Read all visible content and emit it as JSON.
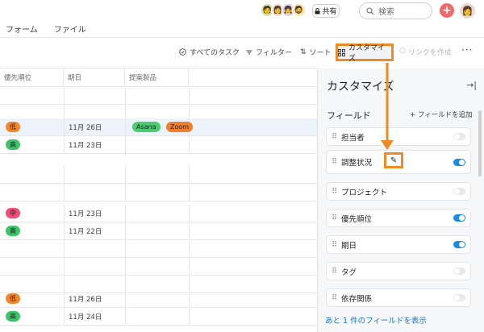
{
  "header": {
    "share_label": "共有",
    "search_placeholder": "検索",
    "add_label": "+",
    "collaborators": [
      "🧑",
      "👩",
      "👧",
      "🧔"
    ]
  },
  "nav": {
    "tabs": [
      "フォーム",
      "ファイル"
    ]
  },
  "toolbar": {
    "all_tasks": "すべてのタスク",
    "filter": "フィルター",
    "sort": "ソート",
    "customize": "カスタマイズ",
    "create_link": "リンクを作成",
    "more": "···"
  },
  "table": {
    "columns": [
      "優先順位",
      "期日",
      "提案製品"
    ],
    "rows": [
      {
        "priority": "",
        "date": "",
        "products": []
      },
      {
        "priority": "",
        "date": "",
        "products": []
      },
      {
        "priority": "低",
        "date": "11月 26日",
        "products": [
          "Asana",
          "Zoom"
        ]
      },
      {
        "priority": "高",
        "date": "11月 23日",
        "products": []
      },
      {
        "priority": "",
        "date": "",
        "products": []
      },
      {
        "priority": "",
        "date": "",
        "products": []
      },
      {
        "priority": "中",
        "date": "11月 23日",
        "products": []
      },
      {
        "priority": "高",
        "date": "11月 22日",
        "products": []
      },
      {
        "priority": "",
        "date": "",
        "products": []
      },
      {
        "priority": "",
        "date": "",
        "products": []
      },
      {
        "priority": "",
        "date": "",
        "products": []
      },
      {
        "priority": "低",
        "date": "11月 26日",
        "products": []
      },
      {
        "priority": "高",
        "date": "11月 24日",
        "products": []
      }
    ]
  },
  "colors": {
    "low": "#f2872d",
    "high": "#3fc46a",
    "medium": "#ed4d78",
    "asana": "#4ecb71",
    "zoom": "#f07f2d",
    "accent_blue": "#1d8ae0",
    "annotation": "#f08a24"
  },
  "panel": {
    "title": "カスタマイズ",
    "fields_heading": "フィールド",
    "add_field": "+ フィールドを追加",
    "fields": [
      {
        "label": "担当者",
        "enabled": false
      },
      {
        "label": "調整状況",
        "enabled": true
      },
      {
        "label": "プロジェクト",
        "enabled": false
      },
      {
        "label": "優先順位",
        "enabled": true
      },
      {
        "label": "期日",
        "enabled": true
      },
      {
        "label": "タグ",
        "enabled": false
      },
      {
        "label": "依存関係",
        "enabled": false
      }
    ],
    "show_more": "あと 1 件のフィールドを表示"
  }
}
